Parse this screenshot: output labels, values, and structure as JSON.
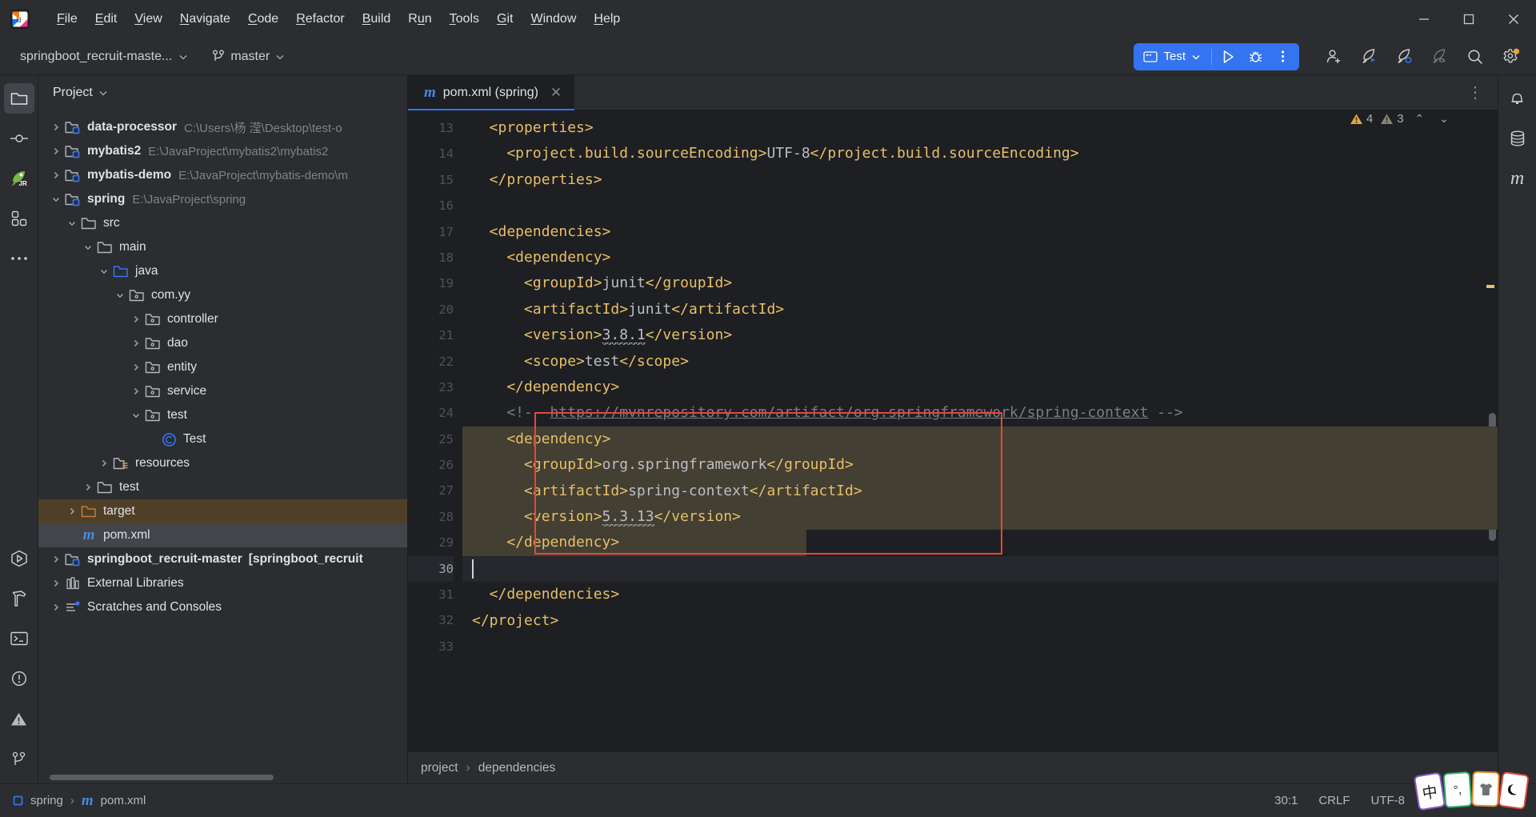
{
  "window": {
    "minimize": "—",
    "maximize": "▢",
    "close": "✕"
  },
  "menu": {
    "items": [
      {
        "label": "File",
        "mnemonic": "F"
      },
      {
        "label": "Edit",
        "mnemonic": "E"
      },
      {
        "label": "View",
        "mnemonic": "V"
      },
      {
        "label": "Navigate",
        "mnemonic": "N"
      },
      {
        "label": "Code",
        "mnemonic": "C"
      },
      {
        "label": "Refactor",
        "mnemonic": "R"
      },
      {
        "label": "Build",
        "mnemonic": "B"
      },
      {
        "label": "Run",
        "mnemonic": "u"
      },
      {
        "label": "Tools",
        "mnemonic": "T"
      },
      {
        "label": "Git",
        "mnemonic": "G"
      },
      {
        "label": "Window",
        "mnemonic": "W"
      },
      {
        "label": "Help",
        "mnemonic": "H"
      }
    ]
  },
  "toolbar": {
    "project_name": "springboot_recruit-maste...",
    "branch_name": "master",
    "run_config_name": "Test",
    "accent_blue": "#3574f0",
    "icons": [
      {
        "name": "add-user-icon",
        "title": "Code With Me"
      },
      {
        "name": "rocket-run-icon",
        "title": "Run with JRebel"
      },
      {
        "name": "rocket-debug-icon",
        "title": "Debug with JRebel"
      },
      {
        "name": "rocket-remote-icon",
        "title": "Remote JRebel"
      },
      {
        "name": "search-icon",
        "title": "Search Everywhere"
      },
      {
        "name": "settings-gear-icon",
        "title": "Settings"
      }
    ]
  },
  "left_stripe": [
    {
      "name": "project-tool-icon",
      "label": "Project",
      "active": true
    },
    {
      "name": "commit-tool-icon",
      "label": "Commit",
      "active": false
    },
    {
      "name": "jrebel-tool-icon",
      "label": "JRebel",
      "active": false
    },
    {
      "name": "structure-tool-icon",
      "label": "Structure",
      "active": false
    },
    {
      "name": "more-tool-icon",
      "label": "More Tool Windows",
      "active": false
    }
  ],
  "left_stripe_bottom": [
    {
      "name": "run-tool-icon",
      "label": "Run"
    },
    {
      "name": "build-tool-icon",
      "label": "Build"
    },
    {
      "name": "terminal-tool-icon",
      "label": "Terminal"
    },
    {
      "name": "problems-tool-icon",
      "label": "Problems"
    },
    {
      "name": "warning-tool-icon",
      "label": "Warnings"
    },
    {
      "name": "git-tool-icon",
      "label": "Git"
    }
  ],
  "right_stripe": [
    {
      "name": "notifications-icon",
      "label": "Notifications"
    },
    {
      "name": "database-tool-icon",
      "label": "Database"
    },
    {
      "name": "maven-tool-icon",
      "label": "Maven"
    }
  ],
  "project_panel": {
    "title": "Project",
    "tree": [
      {
        "depth": 0,
        "arrow": "right",
        "icon": "module-icon",
        "label": "data-processor",
        "bold": true,
        "path": "C:\\Users\\杨 滢\\Desktop\\test-o"
      },
      {
        "depth": 0,
        "arrow": "right",
        "icon": "module-icon",
        "label": "mybatis2",
        "bold": true,
        "path": "E:\\JavaProject\\mybatis2\\mybatis2"
      },
      {
        "depth": 0,
        "arrow": "right",
        "icon": "module-icon",
        "label": "mybatis-demo",
        "bold": true,
        "path": "E:\\JavaProject\\mybatis-demo\\m"
      },
      {
        "depth": 0,
        "arrow": "down",
        "icon": "module-icon",
        "label": "spring",
        "bold": true,
        "path": "E:\\JavaProject\\spring"
      },
      {
        "depth": 1,
        "arrow": "down",
        "icon": "folder-icon",
        "label": "src",
        "bold": false,
        "path": ""
      },
      {
        "depth": 2,
        "arrow": "down",
        "icon": "folder-icon",
        "label": "main",
        "bold": false,
        "path": ""
      },
      {
        "depth": 3,
        "arrow": "down",
        "icon": "source-folder-icon",
        "label": "java",
        "bold": false,
        "path": ""
      },
      {
        "depth": 4,
        "arrow": "down",
        "icon": "package-icon",
        "label": "com.yy",
        "bold": false,
        "path": ""
      },
      {
        "depth": 5,
        "arrow": "right",
        "icon": "package-icon",
        "label": "controller",
        "bold": false,
        "path": ""
      },
      {
        "depth": 5,
        "arrow": "right",
        "icon": "package-icon",
        "label": "dao",
        "bold": false,
        "path": ""
      },
      {
        "depth": 5,
        "arrow": "right",
        "icon": "package-icon",
        "label": "entity",
        "bold": false,
        "path": ""
      },
      {
        "depth": 5,
        "arrow": "right",
        "icon": "package-icon",
        "label": "service",
        "bold": false,
        "path": ""
      },
      {
        "depth": 5,
        "arrow": "down",
        "icon": "package-icon",
        "label": "test",
        "bold": false,
        "path": ""
      },
      {
        "depth": 6,
        "arrow": "none",
        "icon": "class-icon",
        "label": "Test",
        "bold": false,
        "path": ""
      },
      {
        "depth": 3,
        "arrow": "right",
        "icon": "resources-folder-icon",
        "label": "resources",
        "bold": false,
        "path": ""
      },
      {
        "depth": 2,
        "arrow": "right",
        "icon": "folder-icon",
        "label": "test",
        "bold": false,
        "path": ""
      },
      {
        "depth": 1,
        "arrow": "right",
        "icon": "excluded-folder-icon",
        "label": "target",
        "bold": false,
        "path": "",
        "highlight": "excluded"
      },
      {
        "depth": 1,
        "arrow": "none",
        "icon": "maven-file-icon",
        "label": "pom.xml",
        "bold": false,
        "path": "",
        "highlight": "selected"
      },
      {
        "depth": 0,
        "arrow": "right",
        "icon": "module-icon",
        "label": "springboot_recruit-master",
        "bold": true,
        "path": "",
        "suffix": "[springboot_recruit"
      },
      {
        "depth": 0,
        "arrow": "right",
        "icon": "libraries-icon",
        "label": "External Libraries",
        "bold": false,
        "path": ""
      },
      {
        "depth": 0,
        "arrow": "right",
        "icon": "scratches-icon",
        "label": "Scratches and Consoles",
        "bold": false,
        "path": ""
      }
    ]
  },
  "editor": {
    "tab": {
      "label": "pom.xml (spring)",
      "icon": "maven-file-icon",
      "close": "✕"
    },
    "inspections": {
      "warning_count": "4",
      "weak_warning_count": "3",
      "prev": "⌃",
      "next": "⌄"
    },
    "kebab": "⋮",
    "first_line_number": 13,
    "lines": [
      {
        "n": 13,
        "segments": [
          {
            "t": "tag",
            "s": "  <properties>"
          }
        ]
      },
      {
        "n": 14,
        "segments": [
          {
            "t": "tag",
            "s": "    <project.build.sourceEncoding>"
          },
          {
            "t": "txt",
            "s": "UTF-8"
          },
          {
            "t": "tag",
            "s": "</project.build.sourceEncoding>"
          }
        ]
      },
      {
        "n": 15,
        "segments": [
          {
            "t": "tag",
            "s": "  </properties>"
          }
        ]
      },
      {
        "n": 16,
        "segments": [
          {
            "t": "txt",
            "s": ""
          }
        ]
      },
      {
        "n": 17,
        "segments": [
          {
            "t": "tag",
            "s": "  <dependencies>"
          }
        ]
      },
      {
        "n": 18,
        "segments": [
          {
            "t": "tag",
            "s": "    <dependency>"
          }
        ]
      },
      {
        "n": 19,
        "segments": [
          {
            "t": "tag",
            "s": "      <groupId>"
          },
          {
            "t": "txt",
            "s": "junit"
          },
          {
            "t": "tag",
            "s": "</groupId>"
          }
        ]
      },
      {
        "n": 20,
        "segments": [
          {
            "t": "tag",
            "s": "      <artifactId>"
          },
          {
            "t": "txt",
            "s": "junit"
          },
          {
            "t": "tag",
            "s": "</artifactId>"
          }
        ]
      },
      {
        "n": 21,
        "segments": [
          {
            "t": "tag",
            "s": "      <version>"
          },
          {
            "t": "squig",
            "s": "3.8.1"
          },
          {
            "t": "tag",
            "s": "</version>"
          }
        ]
      },
      {
        "n": 22,
        "segments": [
          {
            "t": "tag",
            "s": "      <scope>"
          },
          {
            "t": "txt",
            "s": "test"
          },
          {
            "t": "tag",
            "s": "</scope>"
          }
        ]
      },
      {
        "n": 23,
        "segments": [
          {
            "t": "tag",
            "s": "    </dependency>"
          }
        ]
      },
      {
        "n": 24,
        "segments": [
          {
            "t": "cmt",
            "s": "    <!-- "
          },
          {
            "t": "url",
            "s": "https://mvnrepository.com/artifact/org.springframework/spring-context"
          },
          {
            "t": "cmt",
            "s": " -->"
          }
        ]
      },
      {
        "n": 25,
        "segments": [
          {
            "t": "tag",
            "s": "    <dependency>"
          }
        ],
        "selected": true
      },
      {
        "n": 26,
        "segments": [
          {
            "t": "tag",
            "s": "      <groupId>"
          },
          {
            "t": "txt",
            "s": "org.springframework"
          },
          {
            "t": "tag",
            "s": "</groupId>"
          }
        ],
        "selected": true
      },
      {
        "n": 27,
        "segments": [
          {
            "t": "tag",
            "s": "      <artifactId>"
          },
          {
            "t": "txt",
            "s": "spring-context"
          },
          {
            "t": "tag",
            "s": "</artifactId>"
          }
        ],
        "selected": true
      },
      {
        "n": 28,
        "segments": [
          {
            "t": "tag",
            "s": "      <version>"
          },
          {
            "t": "squig",
            "s": "5.3.13"
          },
          {
            "t": "tag",
            "s": "</version>"
          }
        ],
        "selected": true
      },
      {
        "n": 29,
        "segments": [
          {
            "t": "tag",
            "s": "    </dependency>"
          }
        ],
        "selected": true,
        "bulb": true
      },
      {
        "n": 30,
        "segments": [
          {
            "t": "txt",
            "s": ""
          }
        ],
        "current": true
      },
      {
        "n": 31,
        "segments": [
          {
            "t": "tag",
            "s": "  </dependencies>"
          }
        ]
      },
      {
        "n": 32,
        "segments": [
          {
            "t": "tag",
            "s": "</project>"
          }
        ]
      },
      {
        "n": 33,
        "segments": [
          {
            "t": "txt",
            "s": ""
          }
        ]
      }
    ],
    "breadcrumb": [
      {
        "label": "project"
      },
      {
        "label": "dependencies"
      }
    ]
  },
  "statusbar": {
    "left_crumbs": [
      {
        "icon": "module-small-icon",
        "label": "spring"
      },
      {
        "icon": "maven-file-icon",
        "label": "pom.xml"
      }
    ],
    "separator": "›",
    "caret_position": "30:1",
    "line_separator": "CRLF",
    "encoding": "UTF-8",
    "ime_cards": [
      {
        "glyph": "中",
        "border": "#8a59c7",
        "name": "ime-chinese-mode-card"
      },
      {
        "glyph": "°,",
        "border": "#2faa68",
        "name": "ime-punctuation-card"
      },
      {
        "glyph": "shirt",
        "border": "#e08a2c",
        "name": "ime-skin-card"
      },
      {
        "glyph": "moon",
        "border": "#d9453c",
        "name": "ime-night-mode-card"
      }
    ]
  }
}
